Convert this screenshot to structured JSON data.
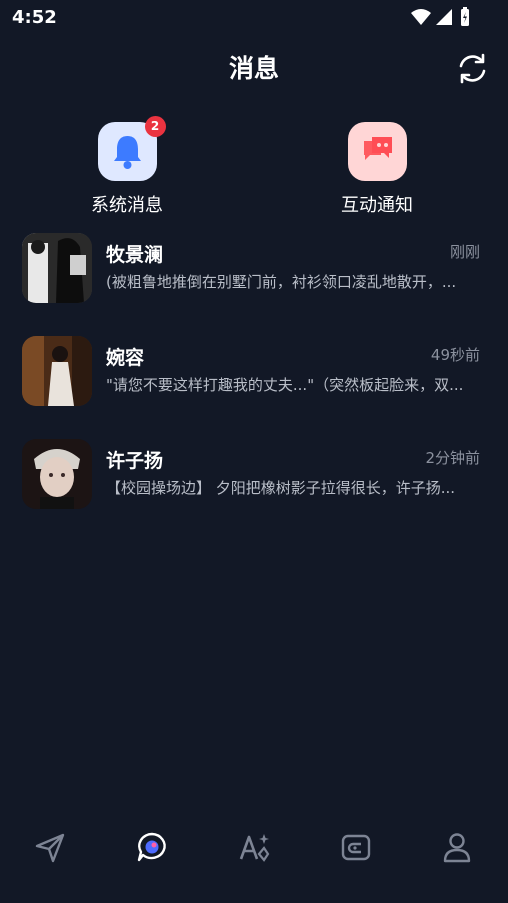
{
  "status_bar": {
    "time": "4:52",
    "icons": [
      "wifi-icon",
      "signal-icon",
      "battery-icon"
    ]
  },
  "header": {
    "title": "消息",
    "refresh_icon": "refresh-icon"
  },
  "quick_actions": [
    {
      "label": "系统消息",
      "icon": "bell-icon",
      "badge": "2"
    },
    {
      "label": "互动通知",
      "icon": "chat-bubble-icon"
    }
  ],
  "chats": [
    {
      "name": "牧景澜",
      "time": "刚刚",
      "preview": "(被粗鲁地推倒在别墅门前，衬衫领口凌乱地散开，..."
    },
    {
      "name": "婉容",
      "time": "49秒前",
      "preview": "\"请您不要这样打趣我的丈夫...\"（突然板起脸来，双..."
    },
    {
      "name": "许子扬",
      "time": "2分钟前",
      "preview": "【校园操场边】 夕阳把橡树影子拉得很长，许子扬..."
    }
  ],
  "tabbar": {
    "items": [
      "send-icon",
      "messages-icon",
      "ai-sparkle-icon",
      "wallet-icon",
      "profile-icon"
    ],
    "active_index": 1
  },
  "colors": {
    "background": "#121826",
    "badge": "#ea3340",
    "muted_text": "#8b919e"
  }
}
